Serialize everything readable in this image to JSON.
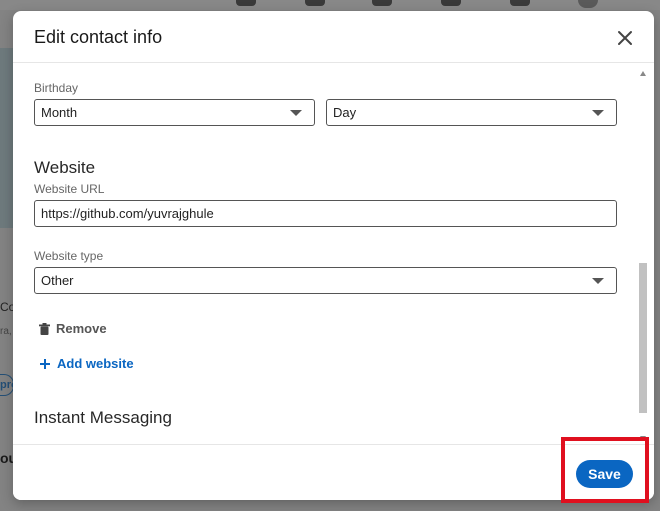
{
  "modal": {
    "title": "Edit contact info",
    "birthday": {
      "label": "Birthday",
      "month_value": "Month",
      "day_value": "Day"
    },
    "website": {
      "heading": "Website",
      "url_label": "Website URL",
      "url_value": "https://github.com/yuvrajghule",
      "type_label": "Website type",
      "type_value": "Other",
      "remove_label": "Remove",
      "add_label": "Add website"
    },
    "instant_messaging": {
      "heading": "Instant Messaging"
    },
    "footer": {
      "save_label": "Save"
    }
  },
  "background": {
    "left_text1": "Co",
    "left_text2": "ra,",
    "left_btn": "pro",
    "left_text3": "ou",
    "colors": {
      "overlay": "#838383"
    }
  },
  "colors": {
    "accent": "#0a66c2",
    "highlight": "#e0101f"
  }
}
